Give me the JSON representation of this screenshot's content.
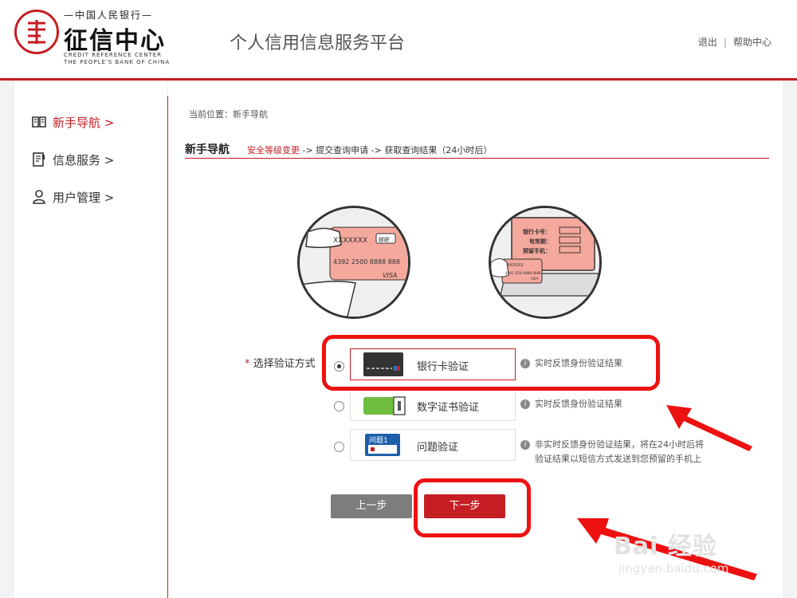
{
  "header": {
    "logo_top": "—中国人民银行—",
    "logo_name": "征信中心",
    "logo_en_line1": "CREDIT REFERENCE CENTER",
    "logo_en_line2": "THE PEOPLE'S BANK OF CHINA",
    "platform_title": "个人信用信息服务平台",
    "links": {
      "logout": "退出",
      "separator": "|",
      "help": "帮助中心"
    }
  },
  "sidebar": {
    "items": [
      {
        "label": "新手导航 >",
        "icon": "book-icon",
        "active": true
      },
      {
        "label": "信息服务 >",
        "icon": "document-icon",
        "active": false
      },
      {
        "label": "用户管理 >",
        "icon": "user-icon",
        "active": false
      }
    ]
  },
  "main": {
    "breadcrumb": "当前位置：新手导航",
    "guide_title": "新手导航",
    "steps": {
      "current": "安全等级变更",
      "rest": " -> 提交查询申请 -> 获取查询结果（24小时后）"
    },
    "illustrations": {
      "card_number_short": "XXXXXXX",
      "card_brand": "银联",
      "card_number": "4392 2500 8888 888",
      "card_visa": "VISA",
      "form_card_label": "银行卡号：",
      "form_expiry_label": "有效期：",
      "form_phone_label": "预留手机：",
      "mini_card_number_short": "XXXXXX",
      "mini_card_number": "4392 2500 8888 8888",
      "mini_card_visa": "VISA"
    },
    "method_label": "选择验证方式",
    "required_mark": "* ",
    "options": [
      {
        "label": "银行卡验证",
        "icon": "bank-card-icon",
        "info": "实时反馈身份验证结果",
        "selected": true
      },
      {
        "label": "数字证书验证",
        "icon": "usb-key-icon",
        "info": "实时反馈身份验证结果",
        "selected": false
      },
      {
        "label": "问题验证",
        "icon": "question-card-icon",
        "icon_text": "问题1",
        "info_line1": "非实时反馈身份验证结果，将在24小时后将",
        "info_line2": "验证结果以短信方式发送到您预留的手机上",
        "selected": false
      }
    ],
    "buttons": {
      "prev": "上一步",
      "next": "下一步"
    }
  },
  "watermark": {
    "brand": "Bai 经验",
    "url": "jingyan.baidu.com"
  },
  "colors": {
    "brand_red": "#c41e24",
    "highlight_red": "#ee1111",
    "prev_gray": "#7d7d7d"
  }
}
